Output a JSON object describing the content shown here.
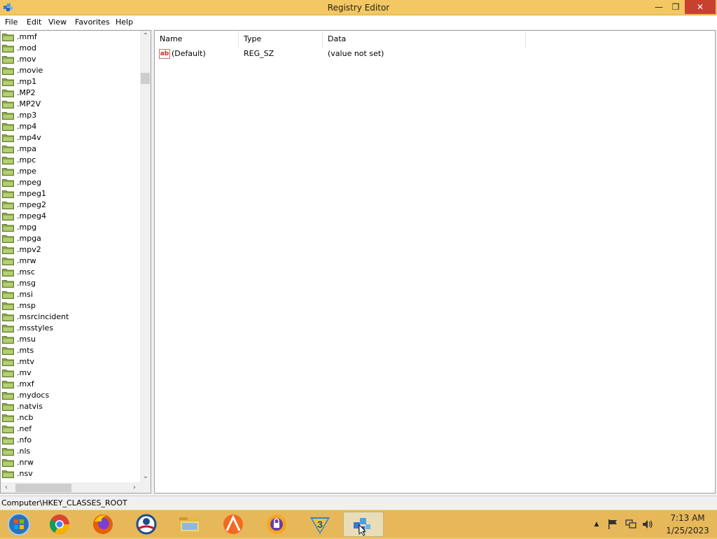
{
  "window": {
    "title": "Registry Editor",
    "minimize_glyph": "—",
    "maximize_glyph": "❐",
    "close_glyph": "✕"
  },
  "menu": [
    "File",
    "Edit",
    "View",
    "Favorites",
    "Help"
  ],
  "tree": {
    "items": [
      ".mmf",
      ".mod",
      ".mov",
      ".movie",
      ".mp1",
      ".MP2",
      ".MP2V",
      ".mp3",
      ".mp4",
      ".mp4v",
      ".mpa",
      ".mpc",
      ".mpe",
      ".mpeg",
      ".mpeg1",
      ".mpeg2",
      ".mpeg4",
      ".mpg",
      ".mpga",
      ".mpv2",
      ".mrw",
      ".msc",
      ".msg",
      ".msi",
      ".msp",
      ".msrcincident",
      ".msstyles",
      ".msu",
      ".mts",
      ".mtv",
      ".mv",
      ".mxf",
      ".mydocs",
      ".natvis",
      ".ncb",
      ".nef",
      ".nfo",
      ".nls",
      ".nrw",
      ".nsv"
    ]
  },
  "values": {
    "columns": [
      "Name",
      "Type",
      "Data"
    ],
    "rows": [
      {
        "icon": "ab",
        "name": "(Default)",
        "type": "REG_SZ",
        "data": "(value not set)"
      }
    ]
  },
  "status": {
    "path": "Computer\\HKEY_CLASSES_ROOT"
  },
  "taskbar": {
    "apps": [
      "start-orb",
      "chrome",
      "firefox",
      "obama-icon",
      "file-explorer",
      "orange-app",
      "vpn-lock",
      "3-app",
      "registry-editor"
    ],
    "clock_time": "7:13 AM",
    "clock_date": "1/25/2023",
    "tray_arrow": "▲"
  },
  "colors": {
    "titlebar": "#f3c763",
    "taskbar": "#e7b85a",
    "close": "#c7412e",
    "folder": "#8ca848"
  }
}
